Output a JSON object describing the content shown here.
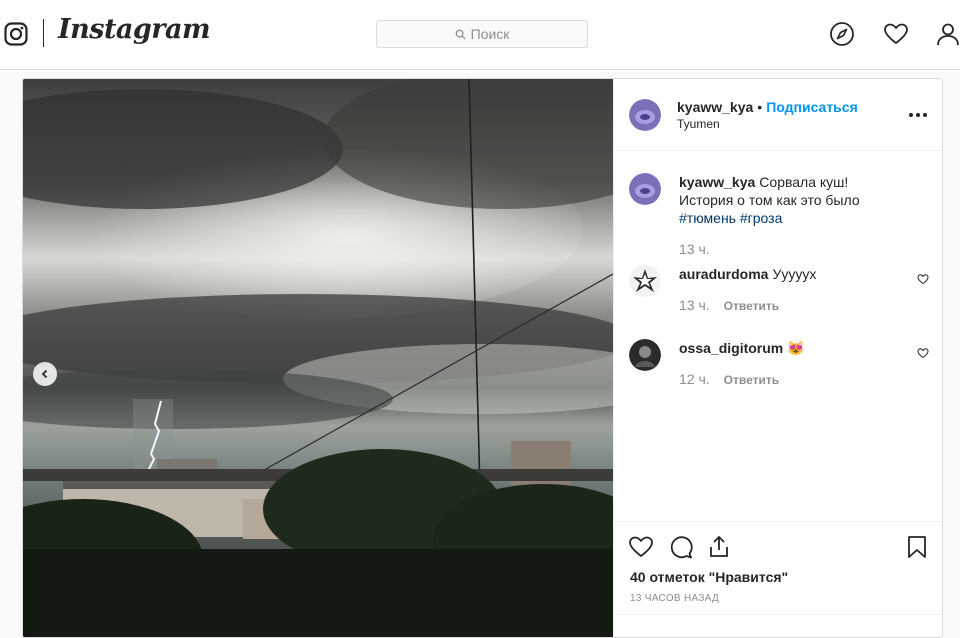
{
  "header": {
    "wordmark": "Instagram",
    "search_placeholder": "Поиск",
    "icons": [
      "instagram-glyph-icon",
      "search-icon",
      "compass-icon",
      "heart-icon",
      "profile-icon"
    ]
  },
  "post": {
    "author": "kyaww_kya",
    "separator": "•",
    "follow_label": "Подписаться",
    "location": "Tyumen",
    "caption": {
      "username": "kyaww_kya",
      "line1": "Сорвала куш!",
      "line2": "История о том как это было",
      "hashtags": [
        "#тюмень",
        "#гроза"
      ],
      "time": "13 ч."
    },
    "comments": [
      {
        "username": "auradurdoma",
        "text": "Уууууx",
        "time": "13 ч.",
        "reply_label": "Ответить"
      },
      {
        "username": "ossa_digitorum",
        "text": "😻",
        "time": "12 ч.",
        "reply_label": "Ответить"
      }
    ],
    "likes_text": "40 отметок \"Нравится\"",
    "time_ago": "13 ЧАСОВ НАЗАД"
  },
  "colors": {
    "accent": "#0095f6",
    "hashtag": "#00376b",
    "muted": "#8e8e8e",
    "border": "#dbdbdb"
  }
}
